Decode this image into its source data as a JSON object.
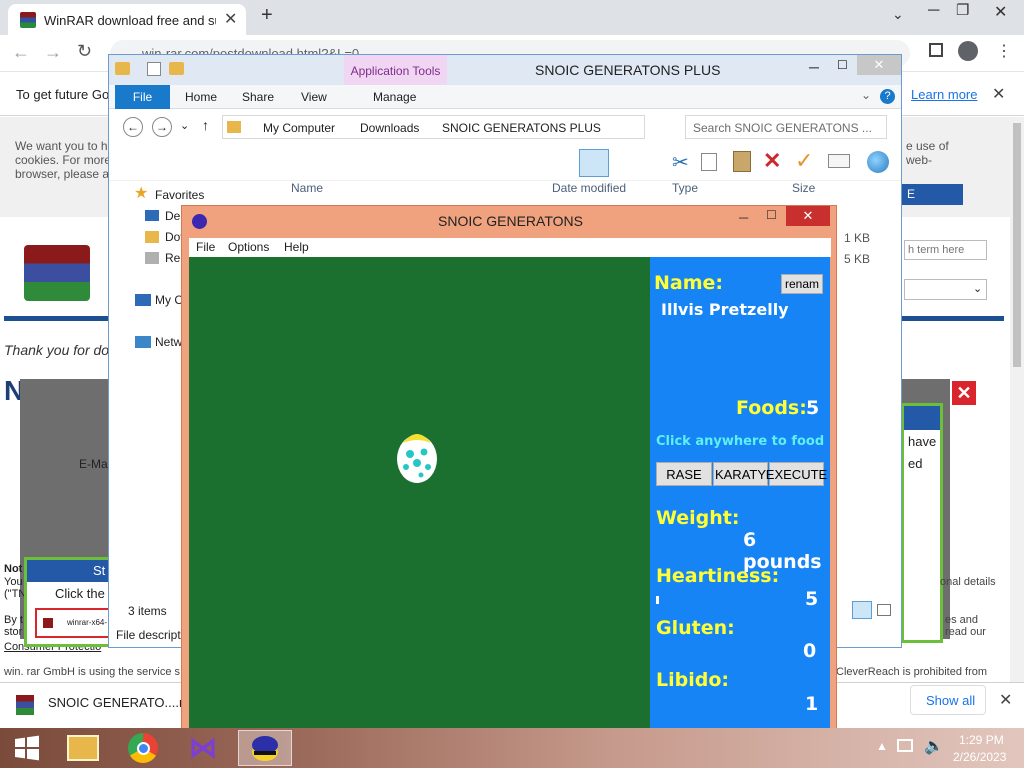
{
  "browser": {
    "tab_title": "WinRAR download free and supp",
    "url": "win-rar.com/postdownload.html?&L=0",
    "infobar_text": "To get future Go",
    "infobar_learn_more": "Learn more"
  },
  "webpage": {
    "cookie_text": "We want you to h\ncookies. For more\nbrowser, please a",
    "cookie_text_right": "e use of\nweb-",
    "cookie_button": "E",
    "search_placeholder": "h term here",
    "thank_you": "Thank you for do",
    "heading": "Now ge",
    "email_label": "E-Ma",
    "have_text": "have",
    "ed_text": "ed",
    "note_label": "Not",
    "note_lines": "You\n(\"TN",
    "by_text": "By t\nstor",
    "consumer": "Consumer Protectio",
    "right_details": "onal details",
    "right_read": "es and\nread our",
    "bottom_left": "win. rar GmbH is using the service s",
    "bottom_right": "CleverReach is prohibited from",
    "popup_title": "St",
    "popup_click": "Click the",
    "popup_file": "winrar-x64-"
  },
  "downloadbar": {
    "filename": "SNOIC GENERATO....rar",
    "show_all": "Show all"
  },
  "taskbar": {
    "time": "1:29 PM",
    "date": "2/26/2023"
  },
  "explorer": {
    "title": "SNOIC GENERATONS PLUS",
    "app_tools": "Application Tools",
    "tabs": [
      "File",
      "Home",
      "Share",
      "View",
      "Manage"
    ],
    "breadcrumb": [
      "My Computer",
      "Downloads",
      "SNOIC GENERATONS PLUS"
    ],
    "search_placeholder": "Search SNOIC GENERATONS ...",
    "columns": [
      "Name",
      "Date modified",
      "Type",
      "Size"
    ],
    "nav": {
      "favorites": "Favorites",
      "desktop": "Des",
      "downloads": "Dov",
      "recent": "Rec",
      "computer": "My C",
      "network": "Netw"
    },
    "sizes": [
      "1 KB",
      "5 KB"
    ],
    "status_items": "3 items",
    "status_desc": "File descripti"
  },
  "game": {
    "title": "SNOIC GENERATONS",
    "menu": [
      "File",
      "Options",
      "Help"
    ],
    "name_label": "Name:",
    "rename_button": "renam",
    "pet_name": "Illvis Pretzelly",
    "foods_label": "Foods:",
    "foods_value": "5",
    "hint": "Click anywhere to food",
    "buttons": [
      "RASE",
      "KARATY",
      "EXECUTE"
    ],
    "weight_label": "Weight:",
    "weight_value": "6 pounds",
    "heartiness_label": "Heartiness:",
    "heartiness_value": "5",
    "gluten_label": "Gluten:",
    "gluten_value": "0",
    "libido_label": "Libido:",
    "libido_value": "1",
    "colors": {
      "canvas": "#1b6f2f",
      "panel": "#1784f6",
      "label": "#ffff33"
    }
  }
}
